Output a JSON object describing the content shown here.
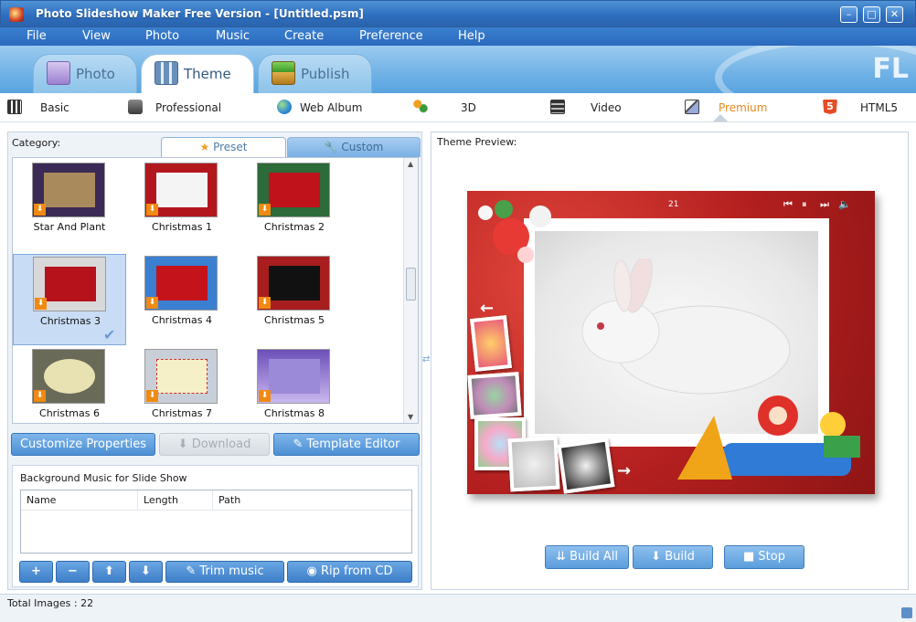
{
  "window": {
    "title": "Photo Slideshow Maker Free Version - [Untitled.psm]"
  },
  "menu": [
    "File",
    "View",
    "Photo",
    "Music",
    "Create",
    "Preference",
    "Help"
  ],
  "main_tabs": [
    {
      "label": "Photo",
      "icon": "photo-album-icon"
    },
    {
      "label": "Theme",
      "icon": "theme-grid-icon",
      "active": true
    },
    {
      "label": "Publish",
      "icon": "publish-box-icon"
    }
  ],
  "brand_watermark": "FL",
  "sub_tabs": [
    {
      "label": "Basic",
      "icon": "piano-icon"
    },
    {
      "label": "Professional",
      "icon": "briefcase-icon"
    },
    {
      "label": "Web Album",
      "icon": "globe-icon"
    },
    {
      "label": "3D",
      "icon": "molecule-icon"
    },
    {
      "label": "Video",
      "icon": "film-icon"
    },
    {
      "label": "Premium",
      "icon": "premium-icon",
      "active": true
    },
    {
      "label": "HTML5",
      "icon": "html5-icon"
    }
  ],
  "left": {
    "category_label": "Category:",
    "preset_tab": "Preset",
    "custom_tab": "Custom",
    "themes": [
      {
        "label": "Star And Plant",
        "color": "#7a5a35"
      },
      {
        "label": "Christmas 1",
        "color": "#ffffff"
      },
      {
        "label": "Christmas 2",
        "color": "#c0121a"
      },
      {
        "label": "Christmas 3",
        "color": "#b5121b",
        "selected": true
      },
      {
        "label": "Christmas 4",
        "color": "#c4131b"
      },
      {
        "label": "Christmas 5",
        "color": "#111111"
      },
      {
        "label": "Christmas 6",
        "color": "#e8e2b3"
      },
      {
        "label": "Christmas 7",
        "color": "#f6f0c8"
      },
      {
        "label": "Christmas 8",
        "color": "#9a8ad8"
      }
    ],
    "actions": {
      "customize": "Customize Properties",
      "download": "Download",
      "template_editor": "Template Editor"
    },
    "music": {
      "group_title": "Background Music for Slide Show",
      "columns": [
        "Name",
        "Length",
        "Path"
      ],
      "trim": "Trim music",
      "rip": "Rip from CD"
    }
  },
  "right": {
    "preview_label": "Theme Preview:",
    "slide_number": "21",
    "buttons": {
      "build_all": "Build All",
      "build": "Build",
      "stop": "Stop"
    }
  },
  "status": {
    "total_images": "Total Images : 22"
  },
  "colors": {
    "accent": "#e58a1c",
    "title_blue": "#2e6fbf",
    "button_blue": "#4c8fd4",
    "download_orange": "#f08a12"
  }
}
